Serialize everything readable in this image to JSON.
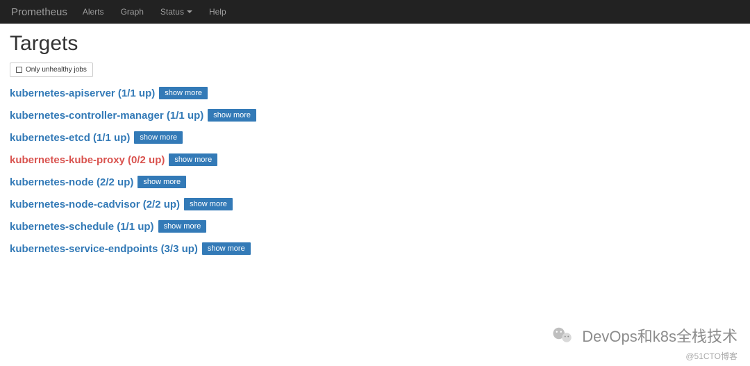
{
  "nav": {
    "brand": "Prometheus",
    "items": [
      {
        "label": "Alerts",
        "dropdown": false
      },
      {
        "label": "Graph",
        "dropdown": false
      },
      {
        "label": "Status",
        "dropdown": true
      },
      {
        "label": "Help",
        "dropdown": false
      }
    ]
  },
  "page_title": "Targets",
  "filter_label": "Only unhealthy jobs",
  "show_more_label": "show more",
  "targets": [
    {
      "name": "kubernetes-apiserver",
      "up": 1,
      "total": 1,
      "healthy": true
    },
    {
      "name": "kubernetes-controller-manager",
      "up": 1,
      "total": 1,
      "healthy": true
    },
    {
      "name": "kubernetes-etcd",
      "up": 1,
      "total": 1,
      "healthy": true
    },
    {
      "name": "kubernetes-kube-proxy",
      "up": 0,
      "total": 2,
      "healthy": false
    },
    {
      "name": "kubernetes-node",
      "up": 2,
      "total": 2,
      "healthy": true
    },
    {
      "name": "kubernetes-node-cadvisor",
      "up": 2,
      "total": 2,
      "healthy": true
    },
    {
      "name": "kubernetes-schedule",
      "up": 1,
      "total": 1,
      "healthy": true
    },
    {
      "name": "kubernetes-service-endpoints",
      "up": 3,
      "total": 3,
      "healthy": true
    }
  ],
  "watermark": {
    "main": "DevOps和k8s全栈技术",
    "small": "@51CTO博客"
  }
}
